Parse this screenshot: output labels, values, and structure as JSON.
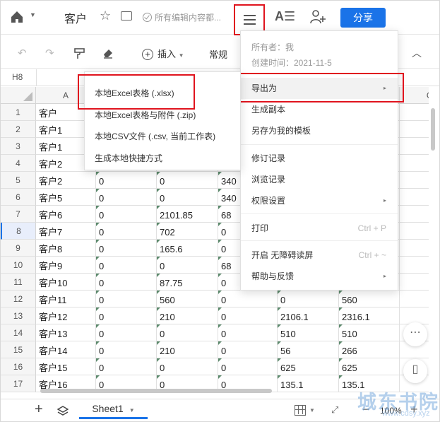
{
  "titlebar": {
    "doc_title": "客户",
    "save_status": "所有编辑内容都...",
    "share_label": "分享",
    "format_icon": "A☰"
  },
  "toolbar": {
    "insert_label": "插入",
    "normal_label": "常规"
  },
  "cell_ref": "H8",
  "columns": [
    "A",
    "G"
  ],
  "rows": [
    {
      "n": "1",
      "a": "客户",
      "b": "",
      "c": "",
      "d": "",
      "e": "",
      "f": ""
    },
    {
      "n": "2",
      "a": "客户1",
      "b": "",
      "c": "",
      "d": "",
      "e": "",
      "f": ""
    },
    {
      "n": "3",
      "a": "客户1",
      "b": "",
      "c": "",
      "d": "",
      "e": "",
      "f": ""
    },
    {
      "n": "4",
      "a": "客户2",
      "b": "",
      "c": "",
      "d": "",
      "e": "",
      "f": ""
    },
    {
      "n": "5",
      "a": "客户2",
      "b": "0",
      "c": "0",
      "d": "340",
      "e": "",
      "f": ""
    },
    {
      "n": "6",
      "a": "客户5",
      "b": "0",
      "c": "0",
      "d": "340",
      "e": "",
      "f": ""
    },
    {
      "n": "7",
      "a": "客户6",
      "b": "0",
      "c": "2101.85",
      "d": "68",
      "e": "",
      "f": ""
    },
    {
      "n": "8",
      "a": "客户7",
      "b": "0",
      "c": "702",
      "d": "0",
      "e": "",
      "f": ""
    },
    {
      "n": "9",
      "a": "客户8",
      "b": "0",
      "c": "165.6",
      "d": "0",
      "e": "",
      "f": ""
    },
    {
      "n": "10",
      "a": "客户9",
      "b": "0",
      "c": "0",
      "d": "68",
      "e": "",
      "f": ""
    },
    {
      "n": "11",
      "a": "客户10",
      "b": "0",
      "c": "87.75",
      "d": "0",
      "e": "",
      "f": ""
    },
    {
      "n": "12",
      "a": "客户11",
      "b": "0",
      "c": "560",
      "d": "0",
      "e": "0",
      "f": "560"
    },
    {
      "n": "13",
      "a": "客户12",
      "b": "0",
      "c": "210",
      "d": "0",
      "e": "2106.1",
      "f": "2316.1"
    },
    {
      "n": "14",
      "a": "客户13",
      "b": "0",
      "c": "0",
      "d": "0",
      "e": "510",
      "f": "510"
    },
    {
      "n": "15",
      "a": "客户14",
      "b": "0",
      "c": "210",
      "d": "0",
      "e": "56",
      "f": "266"
    },
    {
      "n": "16",
      "a": "客户15",
      "b": "0",
      "c": "0",
      "d": "0",
      "e": "625",
      "f": "625"
    },
    {
      "n": "17",
      "a": "客户16",
      "b": "0",
      "c": "0",
      "d": "0",
      "e": "135.1",
      "f": "135.1"
    }
  ],
  "menu": {
    "owner": "所有者：我",
    "created": "创建时间：2021-11-5",
    "items": [
      {
        "label": "导出为",
        "arrow": "▸",
        "shortcut": ""
      },
      {
        "label": "生成副本",
        "arrow": "",
        "shortcut": ""
      },
      {
        "label": "另存为我的模板",
        "arrow": "",
        "shortcut": ""
      },
      {
        "label": "修订记录",
        "arrow": "",
        "shortcut": ""
      },
      {
        "label": "浏览记录",
        "arrow": "",
        "shortcut": ""
      },
      {
        "label": "权限设置",
        "arrow": "▸",
        "shortcut": ""
      },
      {
        "label": "打印",
        "arrow": "",
        "shortcut": "Ctrl + P"
      },
      {
        "label": "开启 无障碍读屏",
        "arrow": "",
        "shortcut": "Ctrl + ~"
      },
      {
        "label": "帮助与反馈",
        "arrow": "▸",
        "shortcut": ""
      }
    ]
  },
  "submenu": {
    "items": [
      "本地Excel表格 (.xlsx)",
      "本地Excel表格与附件 (.zip)",
      "本地CSV文件 (.csv, 当前工作表)",
      "生成本地快捷方式"
    ]
  },
  "bottom": {
    "sheet_name": "Sheet1",
    "zoom": "100%"
  },
  "watermark": {
    "main": "城东书院",
    "sub": "www.cdsy.xyz"
  },
  "colors": {
    "accent": "#1a73e8",
    "highlight_box": "#e0141e"
  }
}
